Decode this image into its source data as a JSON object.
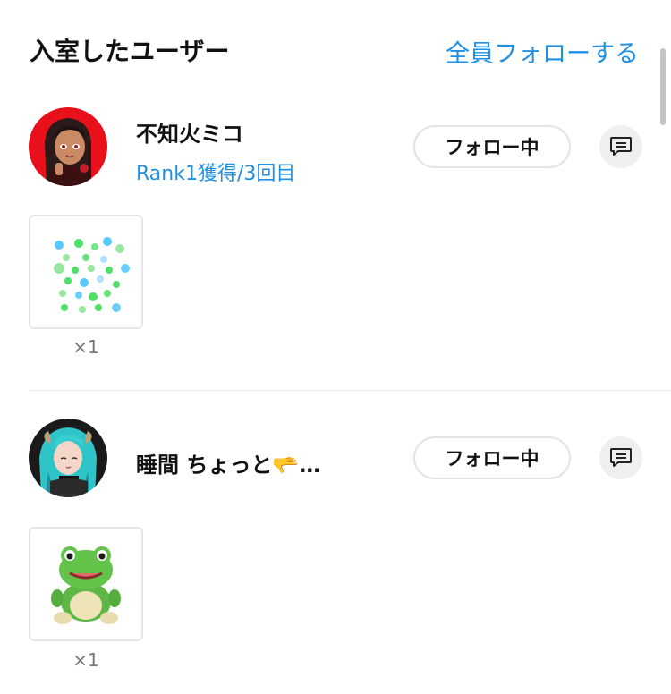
{
  "header": {
    "title": "入室したユーザー",
    "follow_all_label": "全員フォローする"
  },
  "users": [
    {
      "name": "不知火ミコ",
      "rank_text": "Rank1獲得/3回目",
      "follow_label": "フォロー中",
      "avatar_icon": "avatar-red-background-character",
      "gift": {
        "icon": "sparkle-dots-gift-icon",
        "count": "×1"
      }
    },
    {
      "name": "睡間 ちょっと🫳…",
      "follow_label": "フォロー中",
      "avatar_icon": "avatar-teal-hair-character",
      "gift": {
        "icon": "frog-plush-gift-icon",
        "count": "×1"
      }
    }
  ],
  "colors": {
    "accent": "#1e90e6",
    "text": "#111111",
    "muted": "#777777",
    "border": "#e3e3e3",
    "message_bg": "#efefef"
  }
}
